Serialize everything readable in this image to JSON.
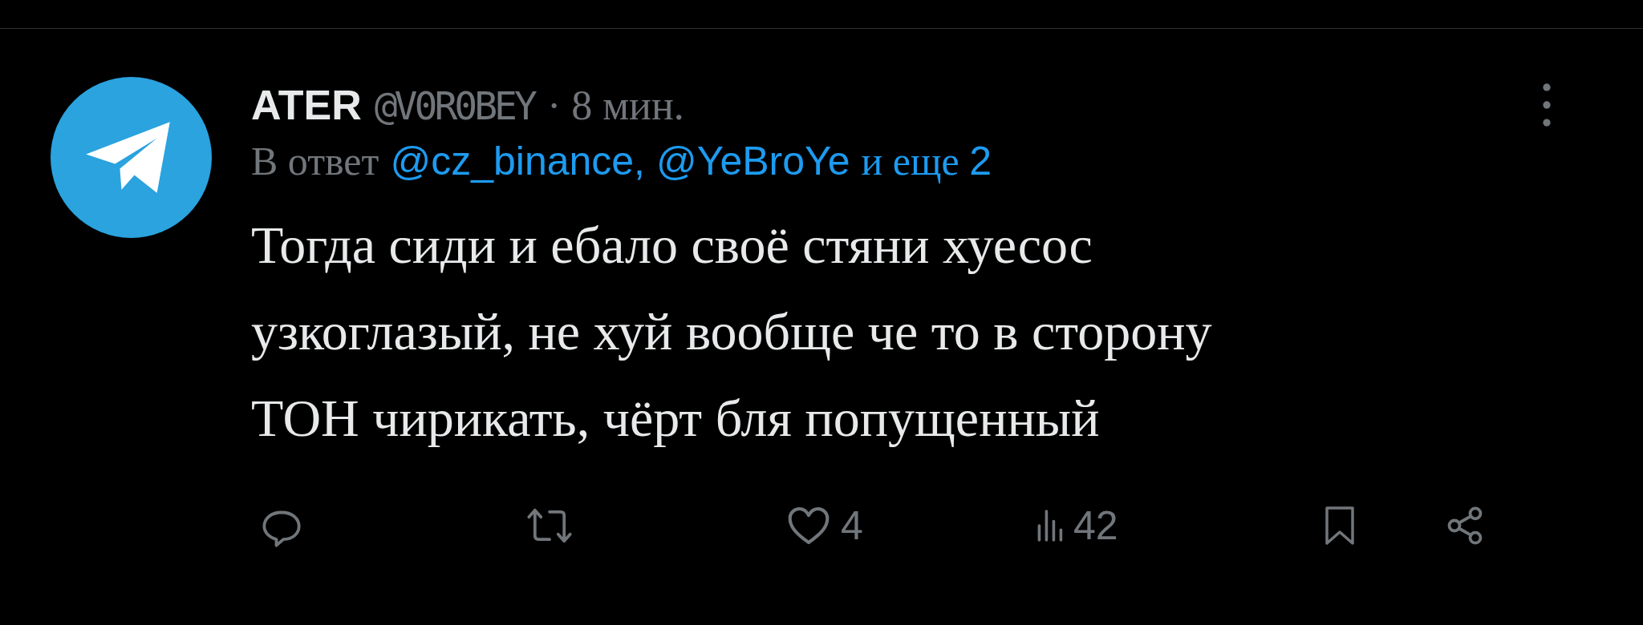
{
  "tweet": {
    "author": {
      "name": "ATER",
      "handle": "@V0R0BEY",
      "time": "· 8 мин."
    },
    "reply_to": {
      "prefix": "В ответ",
      "mentions": "@cz_binance, @YeBroYe",
      "suffix": "и еще",
      "count": "2"
    },
    "text_lines": [
      "Тогда сиди и ебало своё стяни хуесос",
      "узкоглазый, не хуй вообще че то в сторону",
      "ТОН чирикать, чёрт бля попущенный"
    ],
    "actions": [
      {
        "kind": "reply"
      },
      {
        "kind": "retweet"
      },
      {
        "kind": "like",
        "count": "4"
      },
      {
        "kind": "views",
        "count": "42"
      },
      {
        "kind": "bookmark"
      },
      {
        "kind": "share"
      }
    ]
  }
}
